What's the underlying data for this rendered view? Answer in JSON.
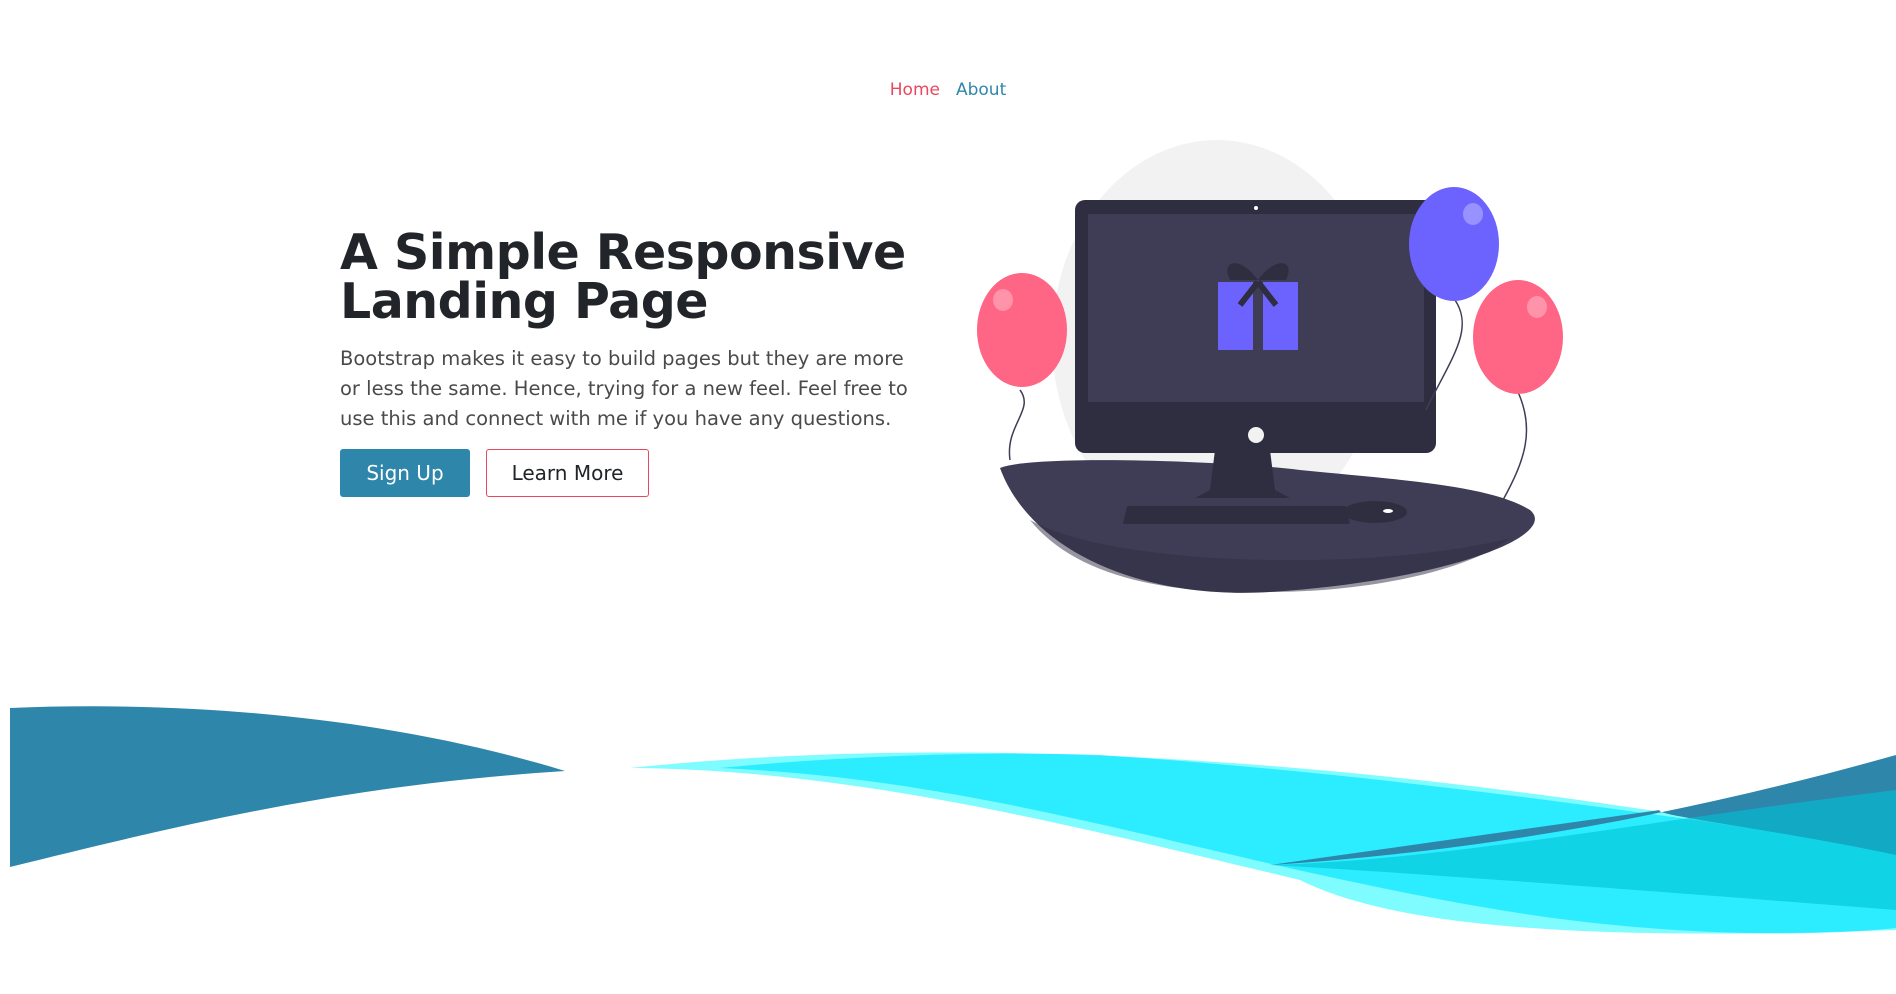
{
  "nav": {
    "home_label": "Home",
    "about_label": "About"
  },
  "hero": {
    "title_line1": "A Simple Responsive",
    "title_line2": "Landing Page",
    "description": "Bootstrap makes it easy to build pages but they are more or less the same. Hence, trying for a new feel. Feel free to use this and connect with me if you have any questions.",
    "signup_label": "Sign Up",
    "learn_more_label": "Learn More"
  },
  "colors": {
    "accent_red": "#e8475f",
    "accent_blue": "#2e86ab",
    "balloon_pink": "#ff6584",
    "balloon_purple": "#6c63ff",
    "dark": "#3f3d56",
    "wave_cyan": "#00e5ff",
    "wave_light_cyan": "#7ffcff"
  },
  "illustration": {
    "icon": "computer-gift-balloons-illustration"
  }
}
